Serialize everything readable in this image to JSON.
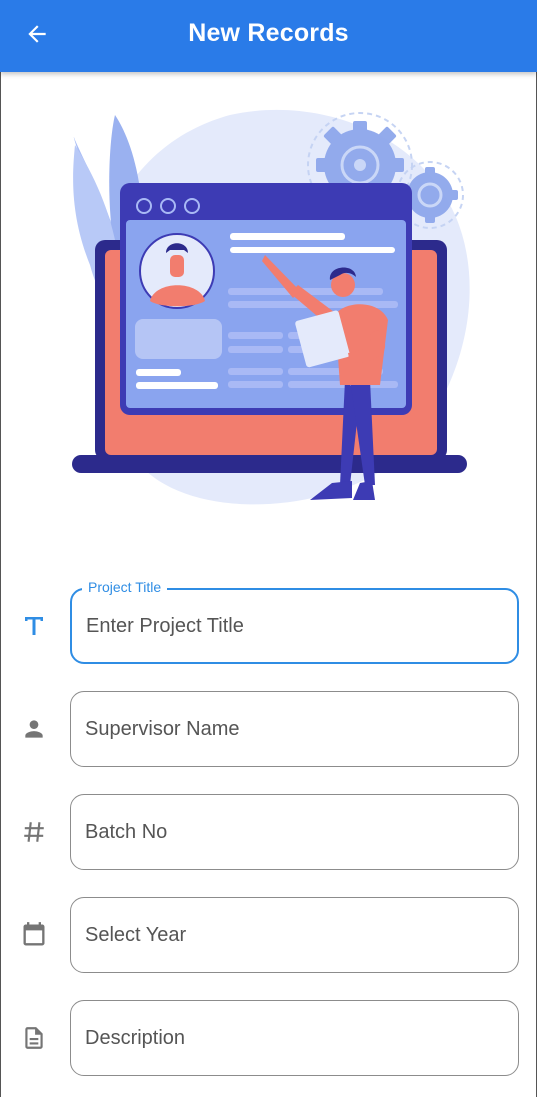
{
  "appbar": {
    "title": "New Records",
    "back_icon": "arrow-left-icon",
    "color": "#2a7be8"
  },
  "form": {
    "fields": [
      {
        "icon": "title-text-icon",
        "label": "Project Title",
        "placeholder": "Enter Project Title",
        "focused": true
      },
      {
        "icon": "person-icon",
        "placeholder": "Supervisor Name"
      },
      {
        "icon": "hash-icon",
        "placeholder": "Batch No"
      },
      {
        "icon": "calendar-icon",
        "placeholder": "Select Year"
      },
      {
        "icon": "document-icon",
        "placeholder": "Description"
      }
    ]
  },
  "colors": {
    "accent": "#2f8de4",
    "icon_gray": "#757575",
    "illustration_purple": "#3d3bb4",
    "illustration_coral": "#f5786a"
  }
}
